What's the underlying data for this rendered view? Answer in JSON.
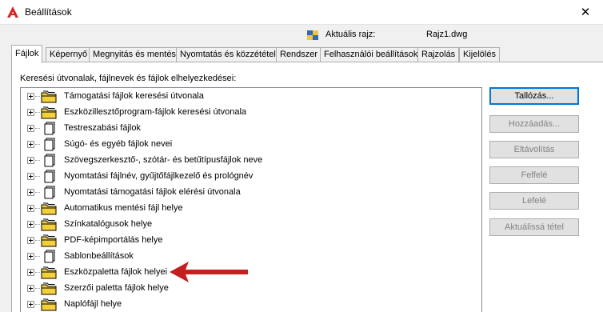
{
  "window": {
    "title": "Beállítások",
    "close_glyph": "✕"
  },
  "current_drawing": {
    "label": "Aktuális rajz:",
    "value": "Rajz1.dwg"
  },
  "tabs": [
    {
      "label": "Fájlok",
      "active": true
    },
    {
      "label": "Képernyő"
    },
    {
      "label": "Megnyitás és mentés"
    },
    {
      "label": "Nyomtatás és közzététel"
    },
    {
      "label": "Rendszer"
    },
    {
      "label": "Felhasználói beállítások"
    },
    {
      "label": "Rajzolás"
    },
    {
      "label": "Kijelölés"
    }
  ],
  "files": {
    "caption": "Keresési útvonalak, fájlnevek és fájlok elhelyezkedései:",
    "items": [
      {
        "label": "Támogatási fájlok keresési útvonala",
        "icon": "folder-stack-icon"
      },
      {
        "label": "Eszközillesztőprogram-fájlok keresési útvonala",
        "icon": "folder-stack-icon"
      },
      {
        "label": "Testreszabási fájlok",
        "icon": "file-stack-icon"
      },
      {
        "label": "Súgó- és egyéb fájlok nevei",
        "icon": "file-stack-icon"
      },
      {
        "label": "Szövegszerkesztő-, szótár- és betűtípusfájlok neve",
        "icon": "file-stack-icon"
      },
      {
        "label": "Nyomtatási fájlnév, gyűjtőfájlkezelő és prológnév",
        "icon": "file-stack-icon"
      },
      {
        "label": "Nyomtatási támogatási fájlok elérési útvonala",
        "icon": "file-stack-icon"
      },
      {
        "label": "Automatikus mentési fájl helye",
        "icon": "folder-stack-icon"
      },
      {
        "label": "Színkatalógusok helye",
        "icon": "folder-stack-icon"
      },
      {
        "label": "PDF-képimportálás helye",
        "icon": "folder-stack-icon"
      },
      {
        "label": "Sablonbeállítások",
        "icon": "file-stack-icon"
      },
      {
        "label": "Eszközpaletta fájlok helyei",
        "icon": "folder-stack-icon"
      },
      {
        "label": "Szerzői paletta fájlok helye",
        "icon": "folder-stack-icon"
      },
      {
        "label": "Naplófájl helye",
        "icon": "folder-stack-icon"
      }
    ]
  },
  "buttons": {
    "browse": "Tallózás...",
    "add": "Hozzáadás...",
    "remove": "Eltávolítás",
    "move_up": "Felfelé",
    "move_down": "Lefelé",
    "set_current": "Aktuálissá tétel"
  },
  "annotation": {
    "arrow_color": "#c41f1f",
    "arrow_target": "Eszközpaletta fájlok helyei"
  }
}
